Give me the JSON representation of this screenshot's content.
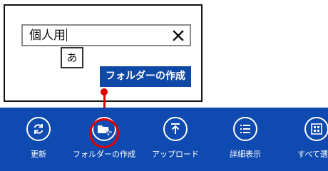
{
  "dialog": {
    "name_value": "個人用",
    "ime_indicator": "あ",
    "create_button_label": "フォルダーの作成"
  },
  "appbar": {
    "commands": [
      {
        "label": "更新",
        "icon": "refresh-icon"
      },
      {
        "label": "フォルダーの作成",
        "icon": "new-folder-icon"
      },
      {
        "label": "アップロード",
        "icon": "upload-icon"
      },
      {
        "label": "詳細表示",
        "icon": "details-list-icon"
      },
      {
        "label": "すべて選択",
        "icon": "select-all-icon"
      }
    ]
  },
  "colors": {
    "appbar_bg": "#0f4ab0",
    "button_bg": "#0f49a8",
    "highlight": "#e00000"
  }
}
